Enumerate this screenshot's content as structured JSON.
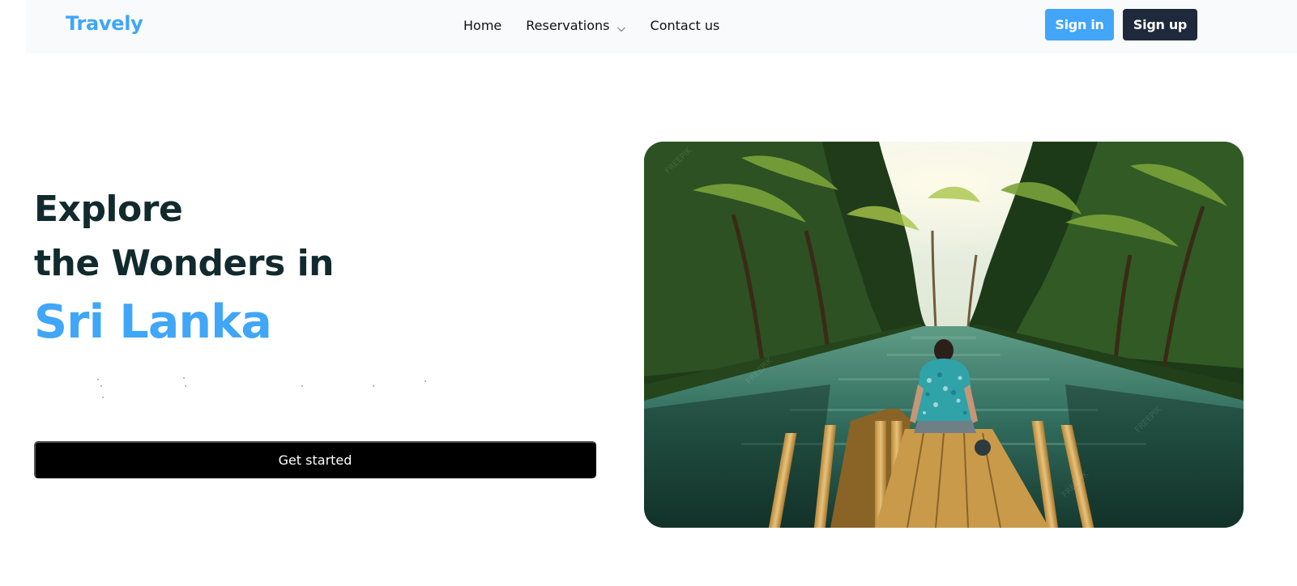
{
  "brand": {
    "name": "Travely"
  },
  "nav": {
    "links": [
      {
        "label": "Home"
      },
      {
        "label": "Reservations"
      },
      {
        "label": "Contact us"
      }
    ],
    "signin_label": "Sign in",
    "signup_label": "Sign up"
  },
  "hero": {
    "line1": "Explore",
    "line2": "the Wonders in",
    "line3": "Sri Lanka",
    "cta_label": "Get started"
  },
  "colors": {
    "brand_blue": "#3fa6f8",
    "heading_dark": "#112a2d",
    "signup_dark": "#1e293b",
    "cta_black": "#000000"
  },
  "icons": {
    "reservations_caret": "chevron-down-icon"
  }
}
